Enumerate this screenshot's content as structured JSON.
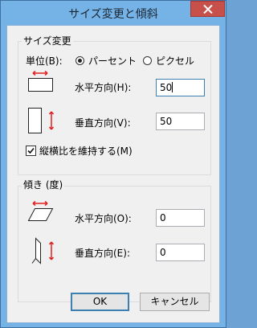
{
  "window": {
    "title": "サイズ変更と傾斜"
  },
  "resize": {
    "legend": "サイズ変更",
    "unit_label": "単位(B):",
    "unit_options": [
      {
        "label": "パーセント",
        "selected": true
      },
      {
        "label": "ピクセル",
        "selected": false
      }
    ],
    "horizontal_label": "水平方向(H):",
    "horizontal_value": "50",
    "vertical_label": "垂直方向(V):",
    "vertical_value": "50",
    "keep_ratio_label": "縦横比を維持する(M)",
    "keep_ratio_checked": true
  },
  "skew": {
    "legend": "傾き (度)",
    "horizontal_label": "水平方向(O):",
    "horizontal_value": "0",
    "vertical_label": "垂直方向(E):",
    "vertical_value": "0"
  },
  "buttons": {
    "ok": "OK",
    "cancel": "キャンセル"
  },
  "colors": {
    "arrow": "#e02020",
    "titlebar": "#75b3e6",
    "close": "#c7504b"
  }
}
